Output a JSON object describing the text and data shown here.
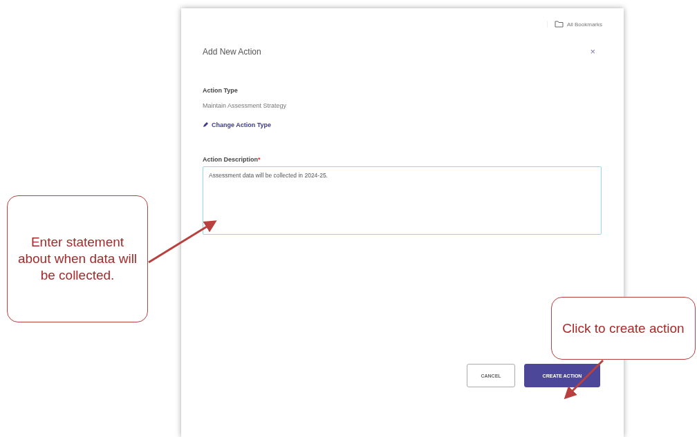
{
  "modal": {
    "bookmarks": "All Bookmarks",
    "title": "Add New Action",
    "close": "×",
    "action_type": {
      "label": "Action Type",
      "value": "Maintain Assessment Strategy",
      "change_link": "Change Action Type"
    },
    "description": {
      "label": "Action Description",
      "required_mark": "*",
      "value": "Assessment data will be collected in 2024-25."
    },
    "buttons": [
      {
        "label": "CANCEL",
        "kind": "secondary"
      },
      {
        "label": "CREATE ACTION",
        "kind": "primary"
      }
    ]
  },
  "annotations": [
    {
      "text": "Enter statement about when data will be collected."
    },
    {
      "text": "Click to create action"
    }
  ]
}
